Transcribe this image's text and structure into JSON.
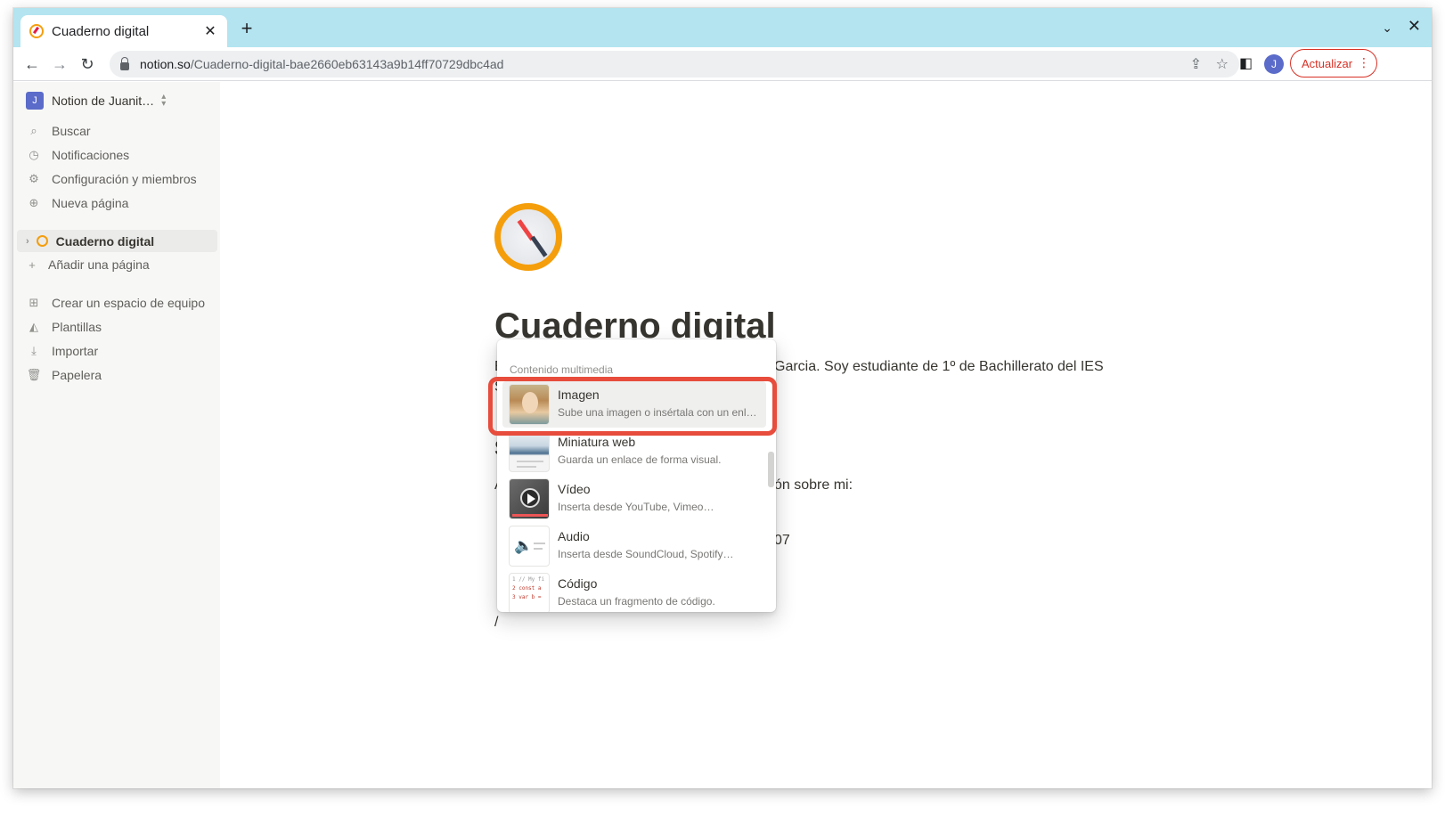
{
  "browser": {
    "tab_title": "Cuaderno digital",
    "tab_close": "✕",
    "new_tab": "+",
    "tab_menu": "⌄",
    "window_close": "✕",
    "url_host": "notion.so",
    "url_path": "/Cuaderno-digital-bae2660eb63143a9b14ff70729dbc4ad",
    "profile_initial": "J",
    "update_label": "Actualizar"
  },
  "sidebar": {
    "workspace_initial": "J",
    "workspace_name": "Notion de Juanit…",
    "items": [
      {
        "label": "Buscar",
        "icon": "search-icon"
      },
      {
        "label": "Notificaciones",
        "icon": "clock-icon"
      },
      {
        "label": "Configuración y miembros",
        "icon": "gear-icon"
      },
      {
        "label": "Nueva página",
        "icon": "plus-circle-icon"
      }
    ],
    "page": "Cuaderno digital",
    "add_page": "Añadir una página",
    "bottom_items": [
      {
        "label": "Crear un espacio de equipo",
        "icon": "team-icon"
      },
      {
        "label": "Plantillas",
        "icon": "templates-icon"
      },
      {
        "label": "Importar",
        "icon": "import-icon"
      },
      {
        "label": "Papelera",
        "icon": "trash-icon"
      }
    ]
  },
  "page": {
    "title": "Cuaderno digital",
    "line1_start": "E",
    "line1_end": "Garcia. Soy estudiante de 1º de Bachillerato del IES",
    "line1b": "S",
    "line2_start": "S",
    "line3_start": "A",
    "line3_end": "ón sobre mi:",
    "line4_end": "07",
    "slash": "/"
  },
  "popup": {
    "header": "Contenido multimedia",
    "items": [
      {
        "title": "Imagen",
        "desc": "Sube una imagen o insértala con un enl…"
      },
      {
        "title": "Miniatura web",
        "desc": "Guarda un enlace de forma visual."
      },
      {
        "title": "Vídeo",
        "desc": "Inserta desde YouTube, Vimeo…"
      },
      {
        "title": "Audio",
        "desc": "Inserta desde SoundCloud, Spotify…"
      },
      {
        "title": "Código",
        "desc": "Destaca un fragmento de código."
      }
    ],
    "code_thumb_lines": [
      "1 // My fi",
      "2 const a",
      "3 var b ="
    ]
  },
  "colors": {
    "tabstrip": "#b3e4f0",
    "highlight": "#e74c3c",
    "accent_orange": "#f59e0b",
    "update_red": "#d93025"
  }
}
